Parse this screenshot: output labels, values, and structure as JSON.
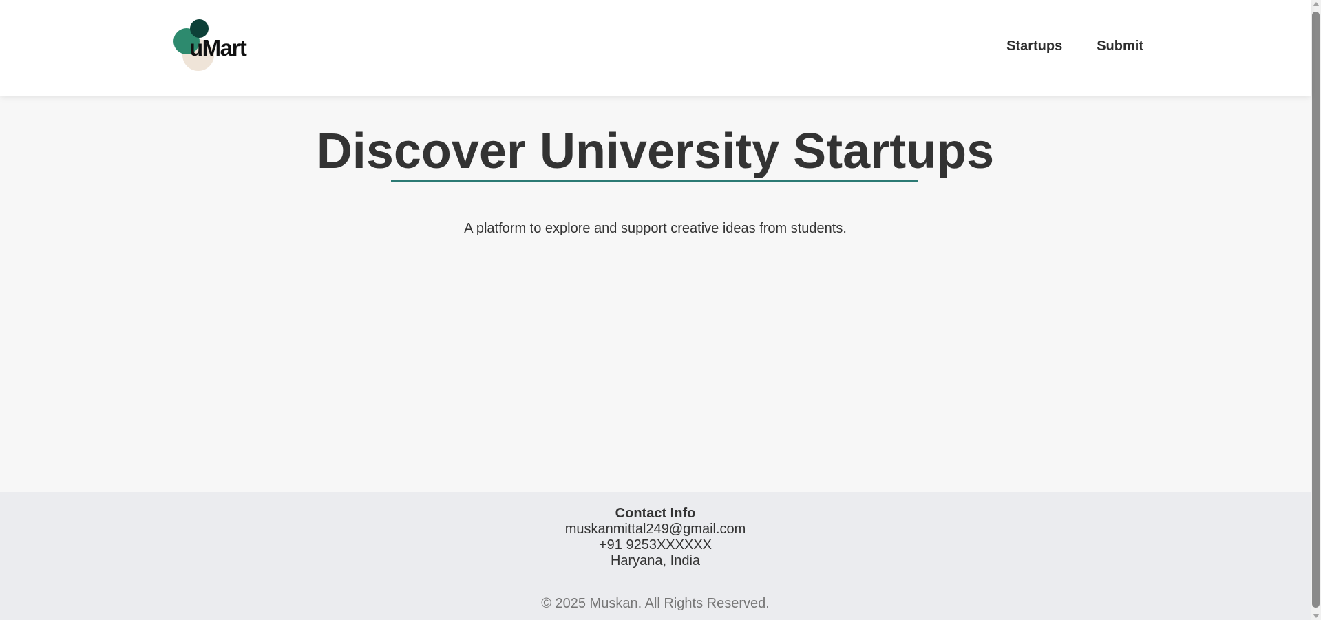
{
  "header": {
    "logo_text": "uMart",
    "nav": [
      {
        "label": "Startups"
      },
      {
        "label": "Submit"
      }
    ]
  },
  "hero": {
    "title": "Discover University Startups",
    "subtitle": "A platform to explore and support creative ideas from students."
  },
  "footer": {
    "contact_heading": "Contact Info",
    "email": "muskanmittal249@gmail.com",
    "phone": "+91 9253XXXXXX",
    "location": "Haryana, India",
    "copyright": "© 2025 Muskan. All Rights Reserved."
  },
  "colors": {
    "accent": "#2c7a74",
    "logo_green": "#2d8a6e",
    "logo_dark": "#0d4038",
    "logo_cream": "#efe4d8"
  }
}
